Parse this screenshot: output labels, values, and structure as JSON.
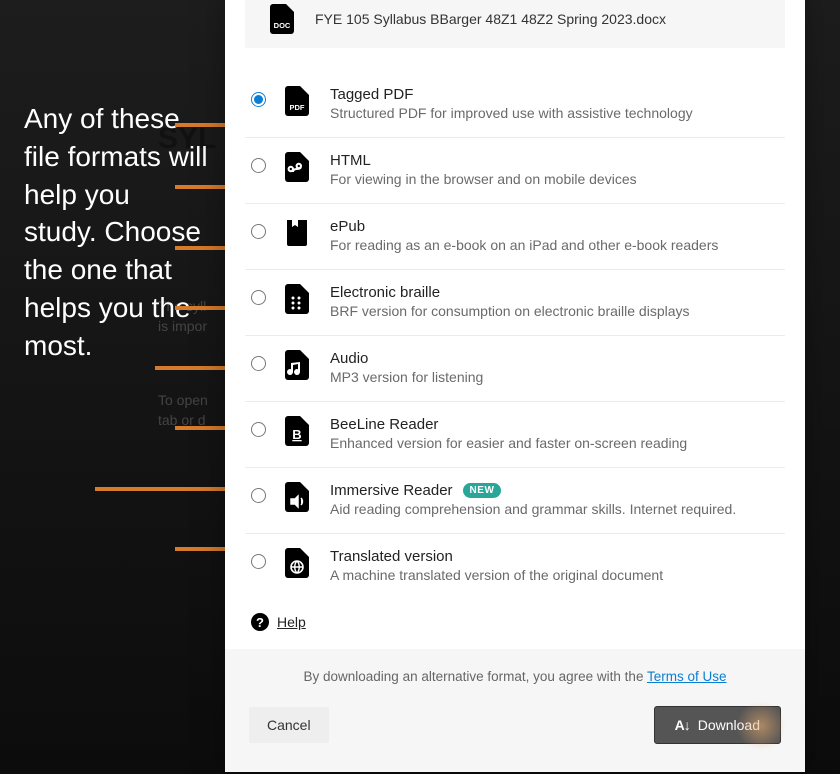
{
  "annotation": {
    "text": "Any of these file formats will help you study. Choose the one that helps you the most."
  },
  "file": {
    "name": "FYE 105 Syllabus BBarger 48Z1 48Z2 Spring 2023.docx",
    "icon_label": "DOC"
  },
  "formats": [
    {
      "id": "pdf",
      "title": "Tagged PDF",
      "desc": "Structured PDF for improved use with assistive technology",
      "icon_text": "PDF",
      "selected": true,
      "badge": ""
    },
    {
      "id": "html",
      "title": "HTML",
      "desc": "For viewing in the browser and on mobile devices",
      "icon_text": "",
      "selected": false,
      "badge": ""
    },
    {
      "id": "epub",
      "title": "ePub",
      "desc": "For reading as an e-book on an iPad and other e-book readers",
      "icon_text": "",
      "selected": false,
      "badge": ""
    },
    {
      "id": "braille",
      "title": "Electronic braille",
      "desc": "BRF version for consumption on electronic braille displays",
      "icon_text": "",
      "selected": false,
      "badge": ""
    },
    {
      "id": "audio",
      "title": "Audio",
      "desc": "MP3 version for listening",
      "icon_text": "",
      "selected": false,
      "badge": ""
    },
    {
      "id": "beeline",
      "title": "BeeLine Reader",
      "desc": "Enhanced version for easier and faster on-screen reading",
      "icon_text": "B",
      "selected": false,
      "badge": ""
    },
    {
      "id": "immersive",
      "title": "Immersive Reader",
      "desc": "Aid reading comprehension and grammar skills. Internet required.",
      "icon_text": "",
      "selected": false,
      "badge": "NEW"
    },
    {
      "id": "translated",
      "title": "Translated version",
      "desc": "A machine translated version of the original document",
      "icon_text": "",
      "selected": false,
      "badge": ""
    }
  ],
  "help": {
    "label": "Help"
  },
  "footer": {
    "terms_prefix": "By downloading an alternative format, you agree with the ",
    "terms_link": "Terms of Use",
    "cancel": "Cancel",
    "download": "Download"
  },
  "bg_fragments": {
    "syl": "SYL",
    "the": "The syll",
    "impor": "is impor",
    "open": "To open",
    "tab": "tab or d"
  }
}
